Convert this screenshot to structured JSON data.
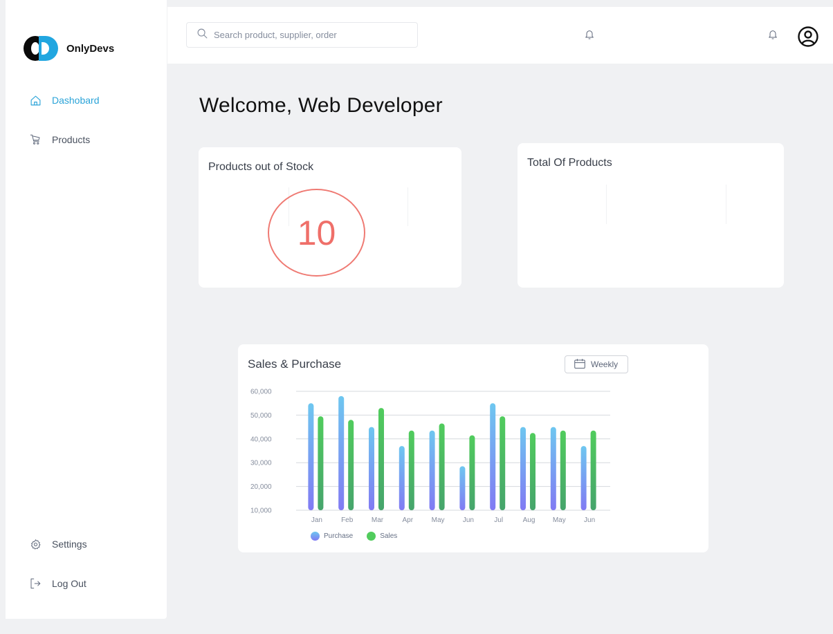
{
  "brand": {
    "name": "OnlyDevs",
    "color_primary": "#21a6e0",
    "color_dark": "#0a0a0a"
  },
  "sidebar": {
    "items": [
      {
        "label": "Dashobard",
        "icon": "home-icon",
        "active": true
      },
      {
        "label": "Products",
        "icon": "cart-icon",
        "active": false
      }
    ],
    "bottom_items": [
      {
        "label": "Settings",
        "icon": "gear-icon"
      },
      {
        "label": "Log Out",
        "icon": "logout-icon"
      }
    ]
  },
  "header": {
    "search_placeholder": "Search product, supplier, order",
    "icons": [
      "bell-icon",
      "bell-icon",
      "user-icon"
    ]
  },
  "main": {
    "welcome": "Welcome, Web Developer",
    "stock_card": {
      "title": "Products out of Stock",
      "value": "10",
      "accent": "#ef6f69"
    },
    "total_card": {
      "title": "Total Of Products"
    }
  },
  "chart": {
    "title": "Sales & Purchase",
    "period_button": "Weekly"
  },
  "chart_data": {
    "type": "bar",
    "categories": [
      "Jan",
      "Feb",
      "Mar",
      "Apr",
      "May",
      "Jun",
      "Jul",
      "Aug",
      "May",
      "Jun"
    ],
    "series": [
      {
        "name": "Purchase",
        "values": [
          55000,
          58000,
          45000,
          37000,
          43500,
          28500,
          55000,
          45000,
          45000,
          37000
        ],
        "color_top": "#6ec7f0",
        "color_bottom": "#817af3"
      },
      {
        "name": "Sales",
        "values": [
          49500,
          48000,
          53000,
          43500,
          46500,
          41500,
          49500,
          42500,
          43500,
          43500
        ],
        "color_top": "#51cc5d",
        "color_bottom": "#46a46c"
      }
    ],
    "y_ticks": [
      "10,000",
      "20,000",
      "30,000",
      "40,000",
      "50,000",
      "60,000"
    ],
    "ylim": [
      10000,
      60000
    ],
    "grid": true,
    "legend_placement": "bottom-left"
  }
}
